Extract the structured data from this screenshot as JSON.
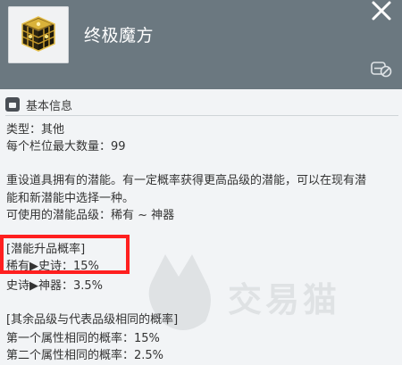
{
  "header": {
    "title": "终极魔方",
    "icons": {
      "item": "cube-icon",
      "close": "close-icon",
      "trade": "trade-restricted-icon"
    }
  },
  "section": {
    "label": "基本信息",
    "icon": "info-box-icon"
  },
  "lines": {
    "type": "类型：其他",
    "max_per_slot": "每个栏位最大数量：99",
    "desc_1": "重设道具拥有的潜能。有一定概率获得更高品级的潜能，可以在现有潜",
    "desc_2": "能和新潜能中选择一种。",
    "usable_grade": "可使用的潜能品级：稀有 ~ 神器",
    "upgrade_header": "[潜能升品概率]",
    "upgrade_rare_epic": "稀有▶史诗：15%",
    "upgrade_epic_legend": "史诗▶神器：3.5%",
    "same_header": "[其余品级与代表品级相同的概率]",
    "same_first": "第一个属性相同的概率：15%",
    "same_second": "第二个属性相同的概率：2.5%"
  },
  "watermark": {
    "text": "交易猫"
  },
  "colors": {
    "header_bg": "#6b7880",
    "body_bg": "#f2f4f6",
    "highlight": "#ff1f1f"
  }
}
